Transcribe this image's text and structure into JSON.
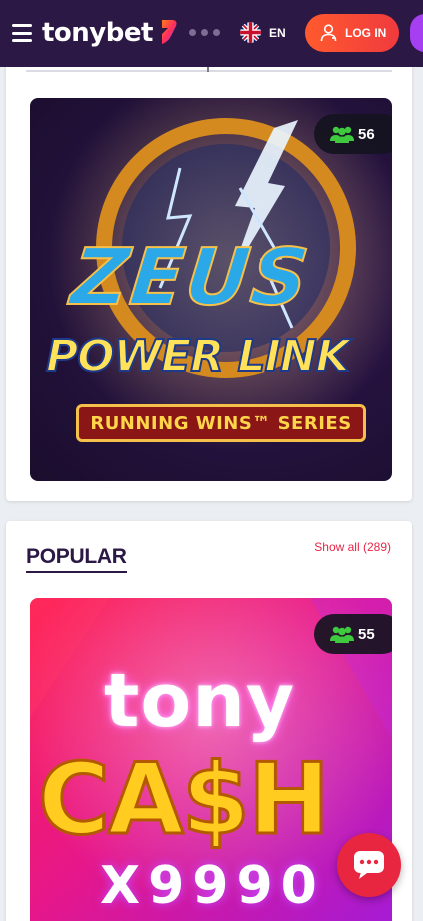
{
  "header": {
    "logo_text": "tonybet",
    "language_code": "EN",
    "login_label": "LOG IN"
  },
  "top_game": {
    "title_line1": "ZEUS",
    "title_line2": "POWER LINK",
    "subtitle": "RUNNING WINS™ SERIES",
    "players": "56"
  },
  "popular": {
    "title": "POPULAR",
    "show_all": "Show all (289)",
    "game": {
      "title_line1": "tony",
      "title_line2": "CA$H",
      "title_line3": "X9990",
      "players": "55"
    }
  },
  "colors": {
    "header_bg": "#2b1844",
    "accent": "#e52848",
    "login_gradient_start": "#ff5a2e",
    "login_gradient_end": "#f03a3e",
    "register": "#a63ef2"
  },
  "icons": {
    "menu": "hamburger-icon",
    "language": "uk-flag-icon",
    "login": "user-icon",
    "players": "users-icon",
    "chat": "chat-bubble-icon"
  }
}
